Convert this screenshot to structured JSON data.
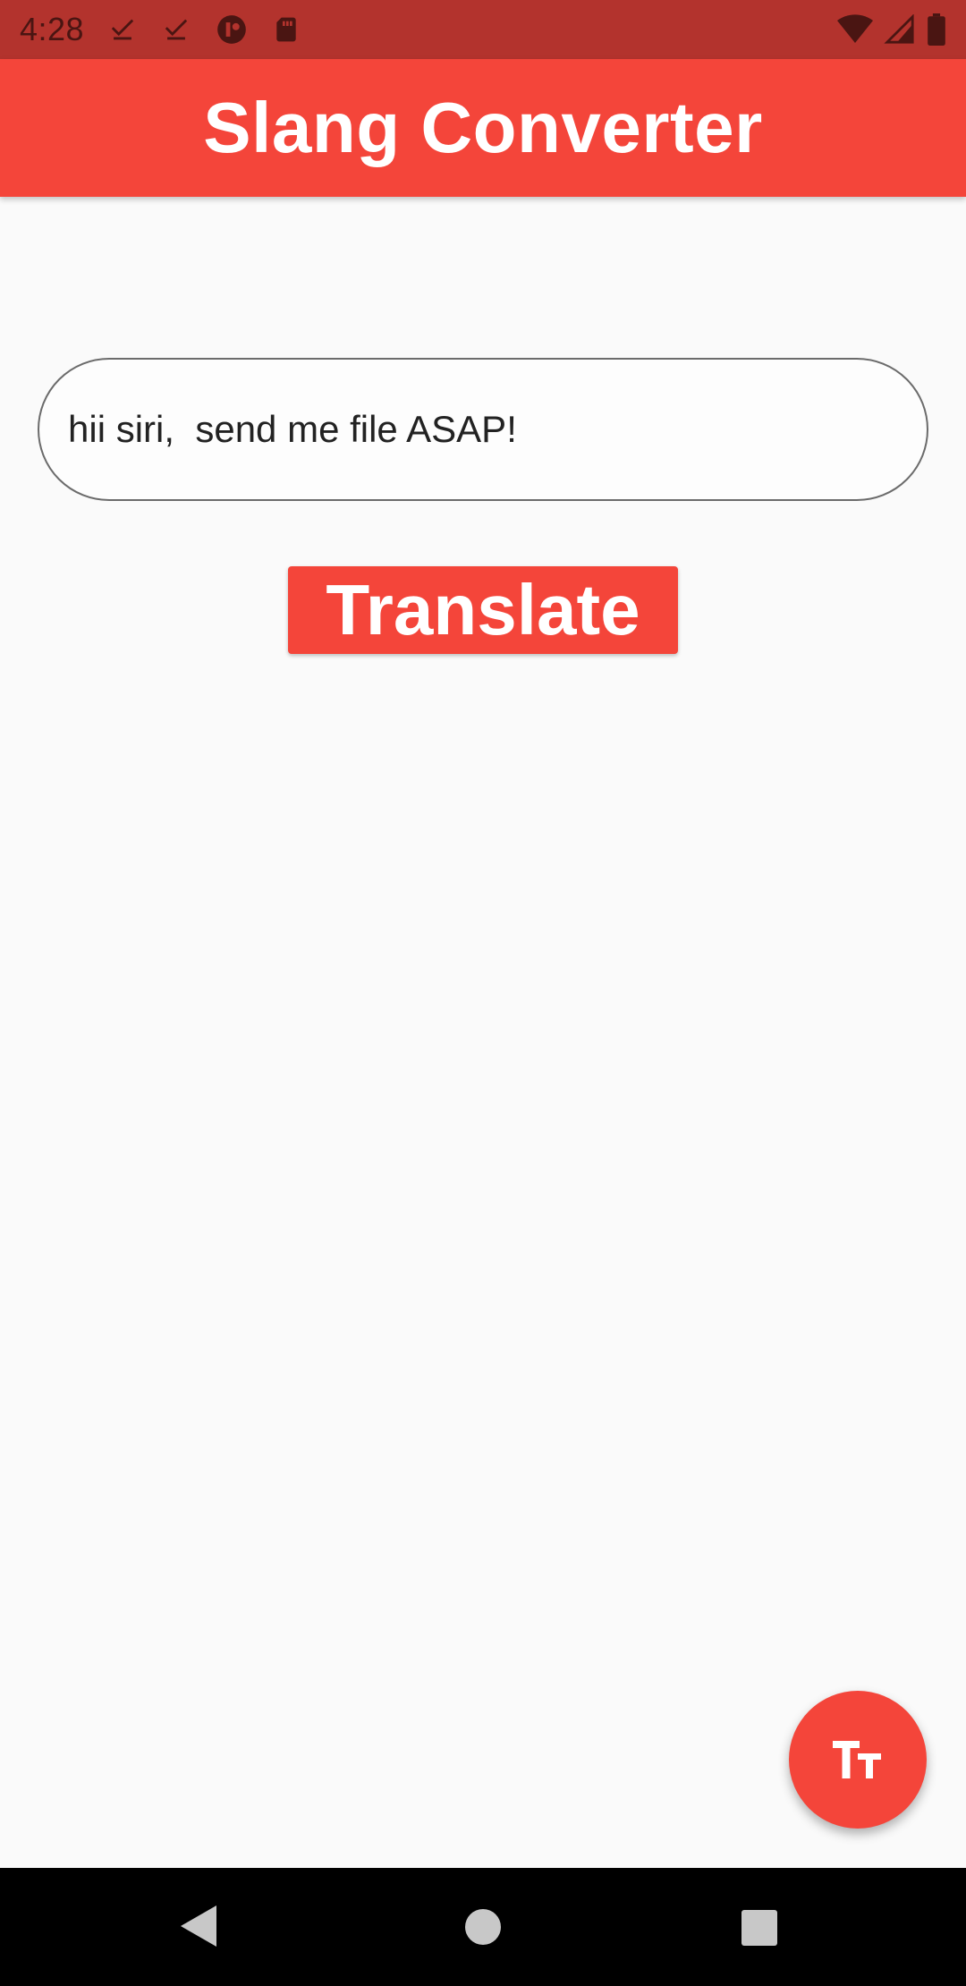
{
  "status_bar": {
    "time": "4:28",
    "left_icons": [
      "download-done-icon",
      "download-done-icon",
      "app-notification-icon",
      "sd-card-icon"
    ],
    "right_icons": [
      "wifi-icon",
      "cell-signal-icon",
      "battery-icon"
    ],
    "color": "#b3332d"
  },
  "app_bar": {
    "title": "Slang Converter",
    "color": "#f4453a"
  },
  "input": {
    "value": "hii siri,  send me file ASAP!"
  },
  "translate_button": {
    "label": "Translate"
  },
  "fab": {
    "icon": "text-size-icon"
  },
  "nav_bar": {
    "buttons": [
      "back-icon",
      "home-icon",
      "recents-icon"
    ]
  }
}
